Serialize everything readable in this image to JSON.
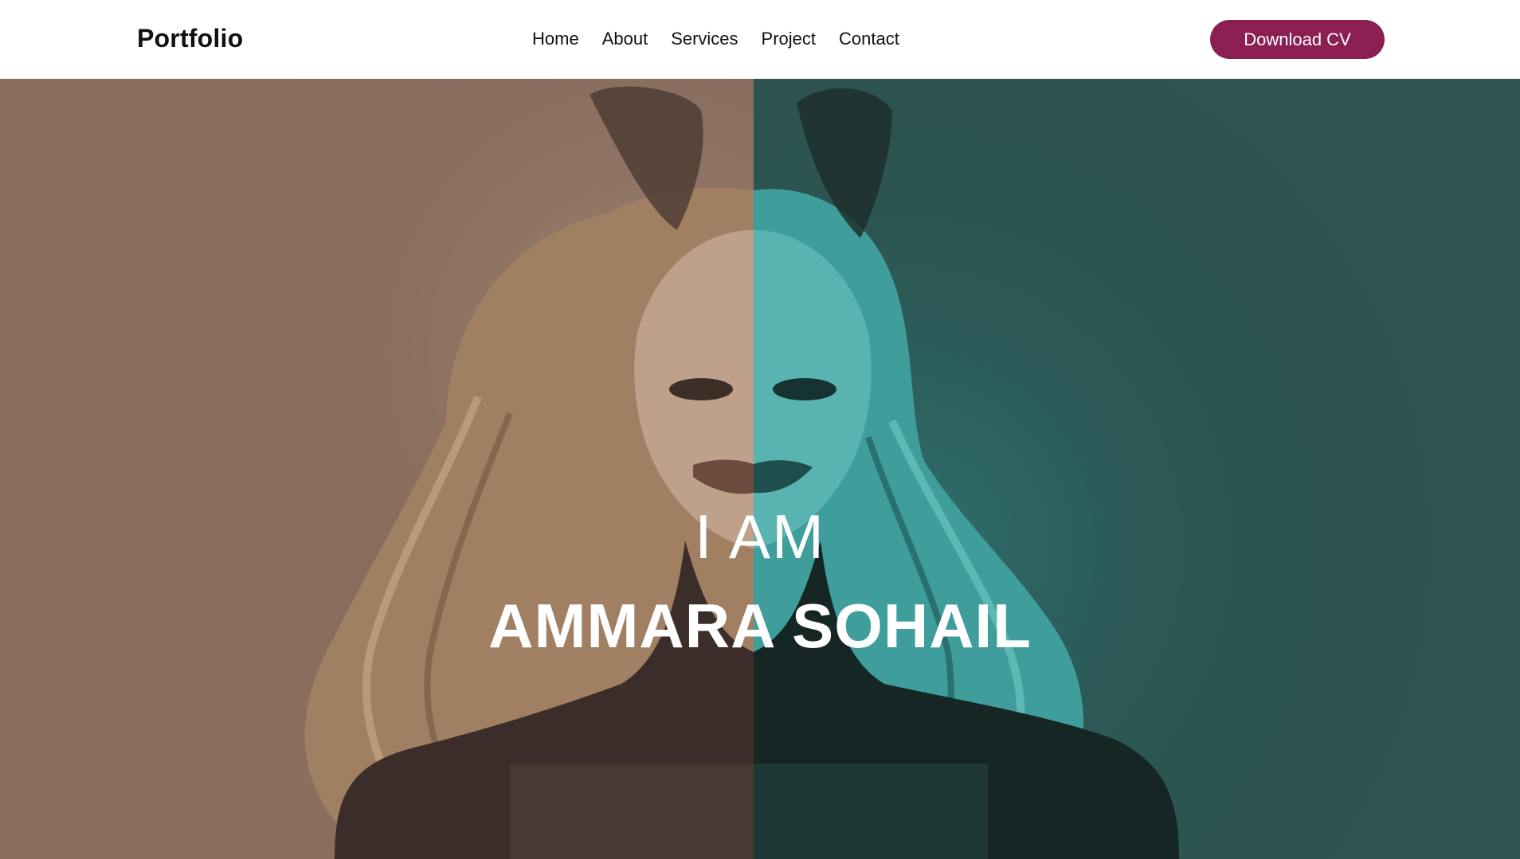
{
  "header": {
    "brand": "Portfolio",
    "nav": [
      "Home",
      "About",
      "Services",
      "Project",
      "Contact"
    ],
    "cta_label": "Download CV"
  },
  "hero": {
    "intro": "I AM",
    "name": "AMMARA SOHAIL",
    "image": "duotone-portrait-photo"
  },
  "colors": {
    "accent": "#8b1f52",
    "left_tone": "#8a6e5e",
    "right_tone": "#2e5552"
  }
}
